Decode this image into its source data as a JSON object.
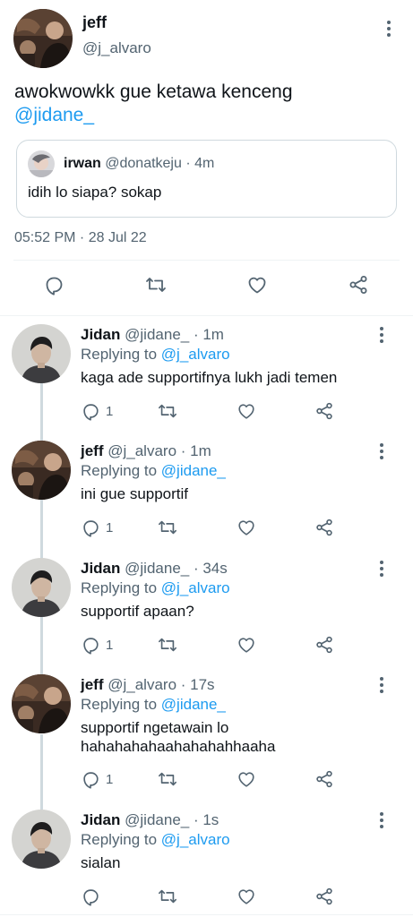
{
  "main_tweet": {
    "name": "jeff",
    "handle": "@j_alvaro",
    "text": "awokwowkk gue ketawa kenceng",
    "mention": "@jidane_",
    "quote": {
      "name": "irwan",
      "handle": "@donatkeju",
      "sep": "·",
      "time": "4m",
      "text": "idih lo siapa? sokap"
    },
    "timestamp": "05:52 PM · 28 Jul 22"
  },
  "replies": [
    {
      "name": "Jidan",
      "handle": "@jidane_",
      "time": "· 1m",
      "replying_label": "Replying to",
      "replying_to": "@j_alvaro",
      "text": "kaga ade supportifnya lukh jadi temen",
      "reply_count": "1",
      "avatar": "jidan"
    },
    {
      "name": "jeff",
      "handle": "@j_alvaro",
      "time": "· 1m",
      "replying_label": "Replying to",
      "replying_to": "@jidane_",
      "text": "ini gue supportif",
      "reply_count": "1",
      "avatar": "jeff"
    },
    {
      "name": "Jidan",
      "handle": "@jidane_",
      "time": "· 34s",
      "replying_label": "Replying to",
      "replying_to": "@j_alvaro",
      "text": "supportif apaan?",
      "reply_count": "1",
      "avatar": "jidan"
    },
    {
      "name": "jeff",
      "handle": "@j_alvaro",
      "time": "· 17s",
      "replying_label": "Replying to",
      "replying_to": "@jidane_",
      "text": "supportif ngetawain lo hahahahahaahahahahhaaha",
      "reply_count": "1",
      "avatar": "jeff"
    },
    {
      "name": "Jidan",
      "handle": "@jidane_",
      "time": "· 1s",
      "replying_label": "Replying to",
      "replying_to": "@j_alvaro",
      "text": "sialan",
      "reply_count": "",
      "avatar": "jidan"
    }
  ],
  "colors": {
    "accent": "#1d9bf0",
    "secondary_text": "#536471",
    "divider": "#eff3f4"
  },
  "icons": [
    "reply-icon",
    "retweet-icon",
    "like-icon",
    "share-icon",
    "more-icon"
  ]
}
